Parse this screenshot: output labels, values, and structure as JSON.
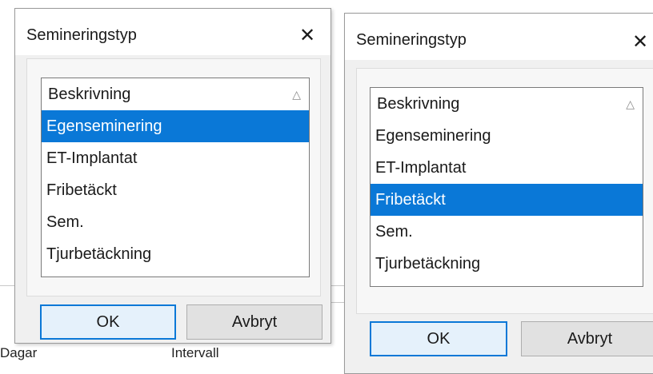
{
  "background": {
    "bottom_left_text": "Dagar",
    "bottom_mid_text": "Intervall"
  },
  "dialogs": [
    {
      "title": "Semineringstyp",
      "close_glyph": "✕",
      "header": "Beskrivning",
      "sort_glyph": "△",
      "items": [
        "Egenseminering",
        "ET-Implantat",
        "Fribetäckt",
        "Sem.",
        "Tjurbetäckning"
      ],
      "selected": "Egenseminering",
      "ok_label": "OK",
      "cancel_label": "Avbryt"
    },
    {
      "title": "Semineringstyp",
      "close_glyph": "✕",
      "header": "Beskrivning",
      "sort_glyph": "△",
      "items": [
        "Egenseminering",
        "ET-Implantat",
        "Fribetäckt",
        "Sem.",
        "Tjurbetäckning"
      ],
      "selected": "Fribetäckt",
      "ok_label": "OK",
      "cancel_label": "Avbryt"
    }
  ],
  "colors": {
    "selection": "#0a78d7",
    "dialog_bg": "#f0f0f0"
  }
}
